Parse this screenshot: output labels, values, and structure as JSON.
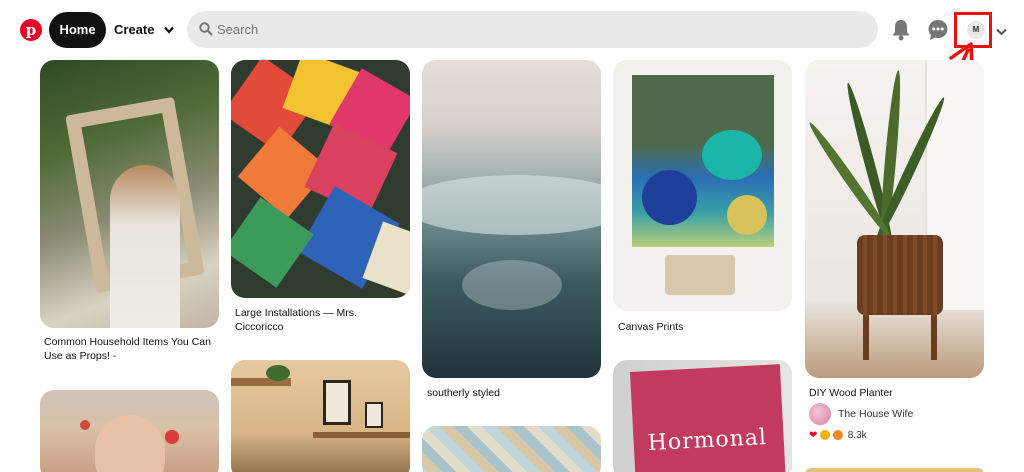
{
  "header": {
    "logo_icon": "pinterest-logo-icon",
    "home_label": "Home",
    "create_label": "Create",
    "search_placeholder": "Search",
    "account_initial": "M",
    "highlight_color": "#e8100e"
  },
  "pins": [
    {
      "title": "Common Household Items You Can Use as Props! -"
    },
    {
      "title": "Large Installations — Mrs. Ciccoricco"
    },
    {
      "title": "southerly styled"
    },
    {
      "title": "Canvas Prints"
    },
    {
      "title": "DIY Wood Planter",
      "author": "The House Wife",
      "reaction_count": "8.3k"
    },
    {
      "title": ""
    },
    {
      "title": ""
    },
    {
      "title": ""
    },
    {
      "title": "",
      "book_text": "Hormonal"
    }
  ],
  "colors": {
    "brand": "#e60023",
    "home_bg": "#111111",
    "search_bg": "#e9e9e9"
  }
}
